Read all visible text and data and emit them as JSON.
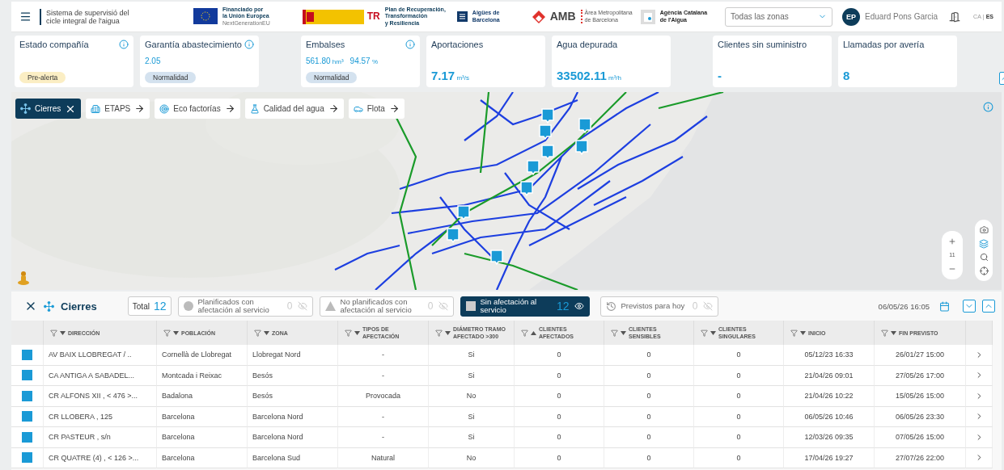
{
  "header": {
    "title_lines": [
      "Sistema de supervisió del",
      "cicle integral de l'aigua"
    ],
    "logos": [
      {
        "kind": "eu",
        "lines": [
          "Financiado por",
          "la Unión Europea",
          "NextGenerationEU"
        ]
      },
      {
        "kind": "spain_gov"
      },
      {
        "kind": "prtr",
        "mark": "TR",
        "lines": [
          "Plan de Recuperación,",
          "Transformación",
          "y Resiliencia"
        ]
      },
      {
        "kind": "aigues",
        "lines": [
          "Aigües de",
          "Barcelona"
        ]
      },
      {
        "kind": "amb",
        "mark": "AMB",
        "lines": [
          "Àrea Metropolitana",
          "de Barcelona"
        ]
      },
      {
        "kind": "aca",
        "lines": [
          "Agència Catalana",
          "de l'Aigua"
        ]
      }
    ],
    "zone_select": "Todas las zonas",
    "avatar": "EP",
    "user": "Eduard Pons Garcia",
    "languages": [
      {
        "label": "CA",
        "selected": false
      },
      {
        "label": "ES",
        "selected": true
      }
    ],
    "language_separator": "|"
  },
  "kpi_groups": [
    [
      {
        "title": "Estado compañía",
        "info": true,
        "kind": "status",
        "badge": {
          "label": "Pre-alerta",
          "kind": "warning"
        }
      },
      {
        "title": "Garantía abastecimiento",
        "info": true,
        "kind": "small",
        "values": [
          {
            "value": "2.05"
          }
        ],
        "badge": {
          "label": "Normalidad",
          "kind": "normal"
        }
      }
    ],
    [
      {
        "title": "Embalses",
        "info": true,
        "kind": "small",
        "values": [
          {
            "value": "561.80",
            "unit": "hm³"
          },
          {
            "value": "94.57",
            "unit": "%"
          }
        ],
        "badge": {
          "label": "Normalidad",
          "kind": "normal"
        }
      },
      {
        "title": "Aportaciones",
        "info": false,
        "kind": "large",
        "values": [
          {
            "value": "7.17",
            "unit": "m³/s"
          }
        ]
      },
      {
        "title": "Agua depurada",
        "info": false,
        "kind": "large",
        "values": [
          {
            "value": "33502.11",
            "unit": "m³/h"
          }
        ]
      }
    ],
    [
      {
        "title": "Clientes sin suministro",
        "info": false,
        "kind": "large",
        "values": [
          {
            "value": "-"
          }
        ]
      },
      {
        "title": "Llamadas por avería",
        "info": false,
        "kind": "large",
        "values": [
          {
            "value": "8"
          }
        ]
      }
    ]
  ],
  "map": {
    "layers": [
      {
        "label": "Cierres",
        "kind": "network",
        "selected": true
      },
      {
        "label": "ETAPS",
        "kind": "plant",
        "selected": false
      },
      {
        "label": "Eco factorías",
        "kind": "target",
        "selected": false
      },
      {
        "label": "Calidad del agua",
        "kind": "flask",
        "selected": false
      },
      {
        "label": "Flota",
        "kind": "car",
        "selected": false
      }
    ],
    "zoom_level": "11"
  },
  "panel": {
    "title": "Cierres",
    "total_label": "Total",
    "total": "12",
    "filters": [
      {
        "label": "Planificados con afectación al servicio",
        "kind": "circle",
        "count": "0",
        "selected": false
      },
      {
        "label": "No planificados con afectación al servicio",
        "kind": "triangle",
        "count": "0",
        "selected": false
      },
      {
        "label": "Sin afectación al servicio",
        "kind": "square",
        "count": "12",
        "selected": true
      },
      {
        "label": "Previstos para hoy",
        "kind": "clock",
        "count": "0",
        "selected": false
      }
    ],
    "date": "06/05/26 16:05"
  },
  "table": {
    "columns": [
      {
        "label": "DIRECCIÓN",
        "ascending": false
      },
      {
        "label": "POBLACIÓN",
        "ascending": false
      },
      {
        "label": "ZONA",
        "ascending": false
      },
      {
        "label": "TIPOS DE AFECTACIÓN",
        "ascending": false
      },
      {
        "label": "DIÁMETRO TRAMO AFECTADO >300",
        "ascending": false
      },
      {
        "label": "CLIENTES AFECTADOS",
        "ascending": true
      },
      {
        "label": "CLIENTES SENSIBLES",
        "ascending": false
      },
      {
        "label": "CLIENTES SINGULARES",
        "ascending": false
      },
      {
        "label": "INICIO",
        "ascending": false
      },
      {
        "label": "FIN PREVISTO",
        "ascending": false
      }
    ],
    "rows": [
      {
        "color": "#1a9ad6",
        "cells": [
          "AV BAIX LLOBREGAT / ..",
          "Cornellà de Llobregat",
          "Llobregat Nord",
          "-",
          "Si",
          "0",
          "0",
          "0",
          "05/12/23 16:33",
          "26/01/27 15:00"
        ]
      },
      {
        "color": "#1a9ad6",
        "cells": [
          "CA ANTIGA A SABADEL...",
          "Montcada i Reixac",
          "Besós",
          "-",
          "Si",
          "0",
          "0",
          "0",
          "21/04/26 09:01",
          "27/05/26 17:00"
        ]
      },
      {
        "color": "#1a9ad6",
        "cells": [
          "CR ALFONS XII , < 476 >...",
          "Badalona",
          "Besós",
          "Provocada",
          "No",
          "0",
          "0",
          "0",
          "21/04/26 10:22",
          "15/05/26 15:00"
        ]
      },
      {
        "color": "#1a9ad6",
        "cells": [
          "CR LLOBERA , 125",
          "Barcelona",
          "Barcelona Nord",
          "-",
          "Si",
          "0",
          "0",
          "0",
          "06/05/26 10:46",
          "06/05/26 23:30"
        ]
      },
      {
        "color": "#1a9ad6",
        "cells": [
          "CR PASTEUR , s/n",
          "Barcelona",
          "Barcelona Nord",
          "-",
          "Si",
          "0",
          "0",
          "0",
          "12/03/26 09:35",
          "07/05/26 15:00"
        ]
      },
      {
        "color": "#1a9ad6",
        "cells": [
          "CR QUATRE (4) , < 126 >...",
          "Barcelona",
          "Barcelona Sud",
          "Natural",
          "No",
          "0",
          "0",
          "0",
          "17/04/26 19:27",
          "27/07/26 22:00"
        ]
      }
    ]
  }
}
